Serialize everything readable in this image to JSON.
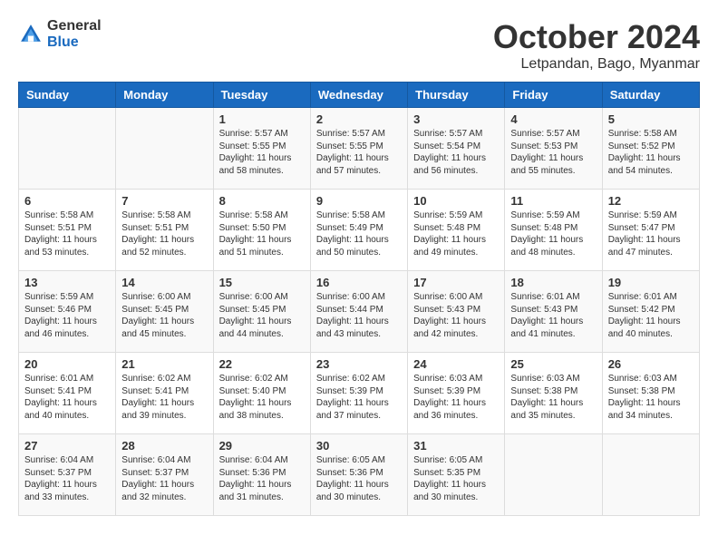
{
  "logo": {
    "general": "General",
    "blue": "Blue"
  },
  "title": "October 2024",
  "subtitle": "Letpandan, Bago, Myanmar",
  "headers": [
    "Sunday",
    "Monday",
    "Tuesday",
    "Wednesday",
    "Thursday",
    "Friday",
    "Saturday"
  ],
  "weeks": [
    [
      {
        "day": "",
        "info": ""
      },
      {
        "day": "",
        "info": ""
      },
      {
        "day": "1",
        "info": "Sunrise: 5:57 AM\nSunset: 5:55 PM\nDaylight: 11 hours and 58 minutes."
      },
      {
        "day": "2",
        "info": "Sunrise: 5:57 AM\nSunset: 5:55 PM\nDaylight: 11 hours and 57 minutes."
      },
      {
        "day": "3",
        "info": "Sunrise: 5:57 AM\nSunset: 5:54 PM\nDaylight: 11 hours and 56 minutes."
      },
      {
        "day": "4",
        "info": "Sunrise: 5:57 AM\nSunset: 5:53 PM\nDaylight: 11 hours and 55 minutes."
      },
      {
        "day": "5",
        "info": "Sunrise: 5:58 AM\nSunset: 5:52 PM\nDaylight: 11 hours and 54 minutes."
      }
    ],
    [
      {
        "day": "6",
        "info": "Sunrise: 5:58 AM\nSunset: 5:51 PM\nDaylight: 11 hours and 53 minutes."
      },
      {
        "day": "7",
        "info": "Sunrise: 5:58 AM\nSunset: 5:51 PM\nDaylight: 11 hours and 52 minutes."
      },
      {
        "day": "8",
        "info": "Sunrise: 5:58 AM\nSunset: 5:50 PM\nDaylight: 11 hours and 51 minutes."
      },
      {
        "day": "9",
        "info": "Sunrise: 5:58 AM\nSunset: 5:49 PM\nDaylight: 11 hours and 50 minutes."
      },
      {
        "day": "10",
        "info": "Sunrise: 5:59 AM\nSunset: 5:48 PM\nDaylight: 11 hours and 49 minutes."
      },
      {
        "day": "11",
        "info": "Sunrise: 5:59 AM\nSunset: 5:48 PM\nDaylight: 11 hours and 48 minutes."
      },
      {
        "day": "12",
        "info": "Sunrise: 5:59 AM\nSunset: 5:47 PM\nDaylight: 11 hours and 47 minutes."
      }
    ],
    [
      {
        "day": "13",
        "info": "Sunrise: 5:59 AM\nSunset: 5:46 PM\nDaylight: 11 hours and 46 minutes."
      },
      {
        "day": "14",
        "info": "Sunrise: 6:00 AM\nSunset: 5:45 PM\nDaylight: 11 hours and 45 minutes."
      },
      {
        "day": "15",
        "info": "Sunrise: 6:00 AM\nSunset: 5:45 PM\nDaylight: 11 hours and 44 minutes."
      },
      {
        "day": "16",
        "info": "Sunrise: 6:00 AM\nSunset: 5:44 PM\nDaylight: 11 hours and 43 minutes."
      },
      {
        "day": "17",
        "info": "Sunrise: 6:00 AM\nSunset: 5:43 PM\nDaylight: 11 hours and 42 minutes."
      },
      {
        "day": "18",
        "info": "Sunrise: 6:01 AM\nSunset: 5:43 PM\nDaylight: 11 hours and 41 minutes."
      },
      {
        "day": "19",
        "info": "Sunrise: 6:01 AM\nSunset: 5:42 PM\nDaylight: 11 hours and 40 minutes."
      }
    ],
    [
      {
        "day": "20",
        "info": "Sunrise: 6:01 AM\nSunset: 5:41 PM\nDaylight: 11 hours and 40 minutes."
      },
      {
        "day": "21",
        "info": "Sunrise: 6:02 AM\nSunset: 5:41 PM\nDaylight: 11 hours and 39 minutes."
      },
      {
        "day": "22",
        "info": "Sunrise: 6:02 AM\nSunset: 5:40 PM\nDaylight: 11 hours and 38 minutes."
      },
      {
        "day": "23",
        "info": "Sunrise: 6:02 AM\nSunset: 5:39 PM\nDaylight: 11 hours and 37 minutes."
      },
      {
        "day": "24",
        "info": "Sunrise: 6:03 AM\nSunset: 5:39 PM\nDaylight: 11 hours and 36 minutes."
      },
      {
        "day": "25",
        "info": "Sunrise: 6:03 AM\nSunset: 5:38 PM\nDaylight: 11 hours and 35 minutes."
      },
      {
        "day": "26",
        "info": "Sunrise: 6:03 AM\nSunset: 5:38 PM\nDaylight: 11 hours and 34 minutes."
      }
    ],
    [
      {
        "day": "27",
        "info": "Sunrise: 6:04 AM\nSunset: 5:37 PM\nDaylight: 11 hours and 33 minutes."
      },
      {
        "day": "28",
        "info": "Sunrise: 6:04 AM\nSunset: 5:37 PM\nDaylight: 11 hours and 32 minutes."
      },
      {
        "day": "29",
        "info": "Sunrise: 6:04 AM\nSunset: 5:36 PM\nDaylight: 11 hours and 31 minutes."
      },
      {
        "day": "30",
        "info": "Sunrise: 6:05 AM\nSunset: 5:36 PM\nDaylight: 11 hours and 30 minutes."
      },
      {
        "day": "31",
        "info": "Sunrise: 6:05 AM\nSunset: 5:35 PM\nDaylight: 11 hours and 30 minutes."
      },
      {
        "day": "",
        "info": ""
      },
      {
        "day": "",
        "info": ""
      }
    ]
  ]
}
